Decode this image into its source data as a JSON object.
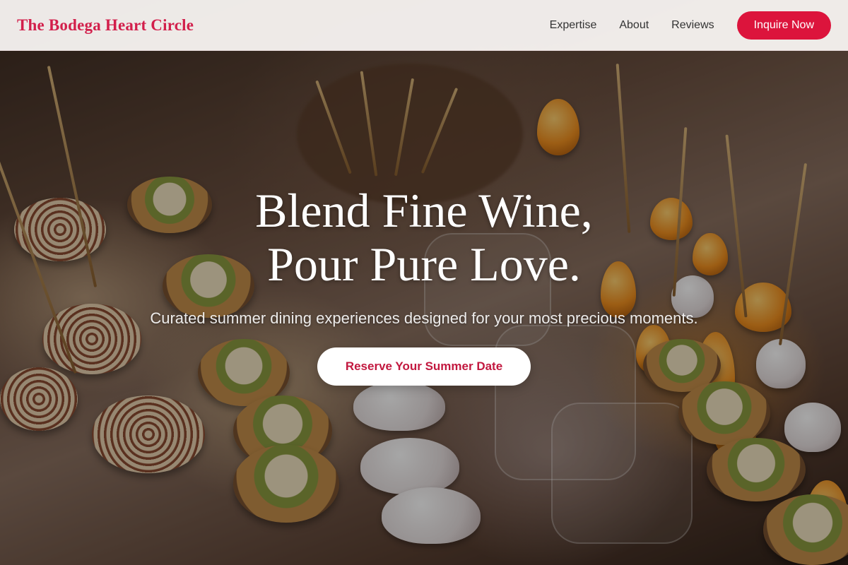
{
  "header": {
    "logo": "The Bodega Heart Circle",
    "nav": [
      {
        "label": "Expertise"
      },
      {
        "label": "About"
      },
      {
        "label": "Reviews"
      }
    ],
    "cta_label": "Inquire Now"
  },
  "hero": {
    "title_line1": "Blend Fine Wine,",
    "title_line2": "Pour Pure Love.",
    "subtitle": "Curated summer dining experiences designed for your most precious moments.",
    "button_label": "Reserve Your Summer Date"
  },
  "colors": {
    "brand": "#dc143c",
    "logo": "#d21f4b",
    "button_text": "#c2183f"
  }
}
